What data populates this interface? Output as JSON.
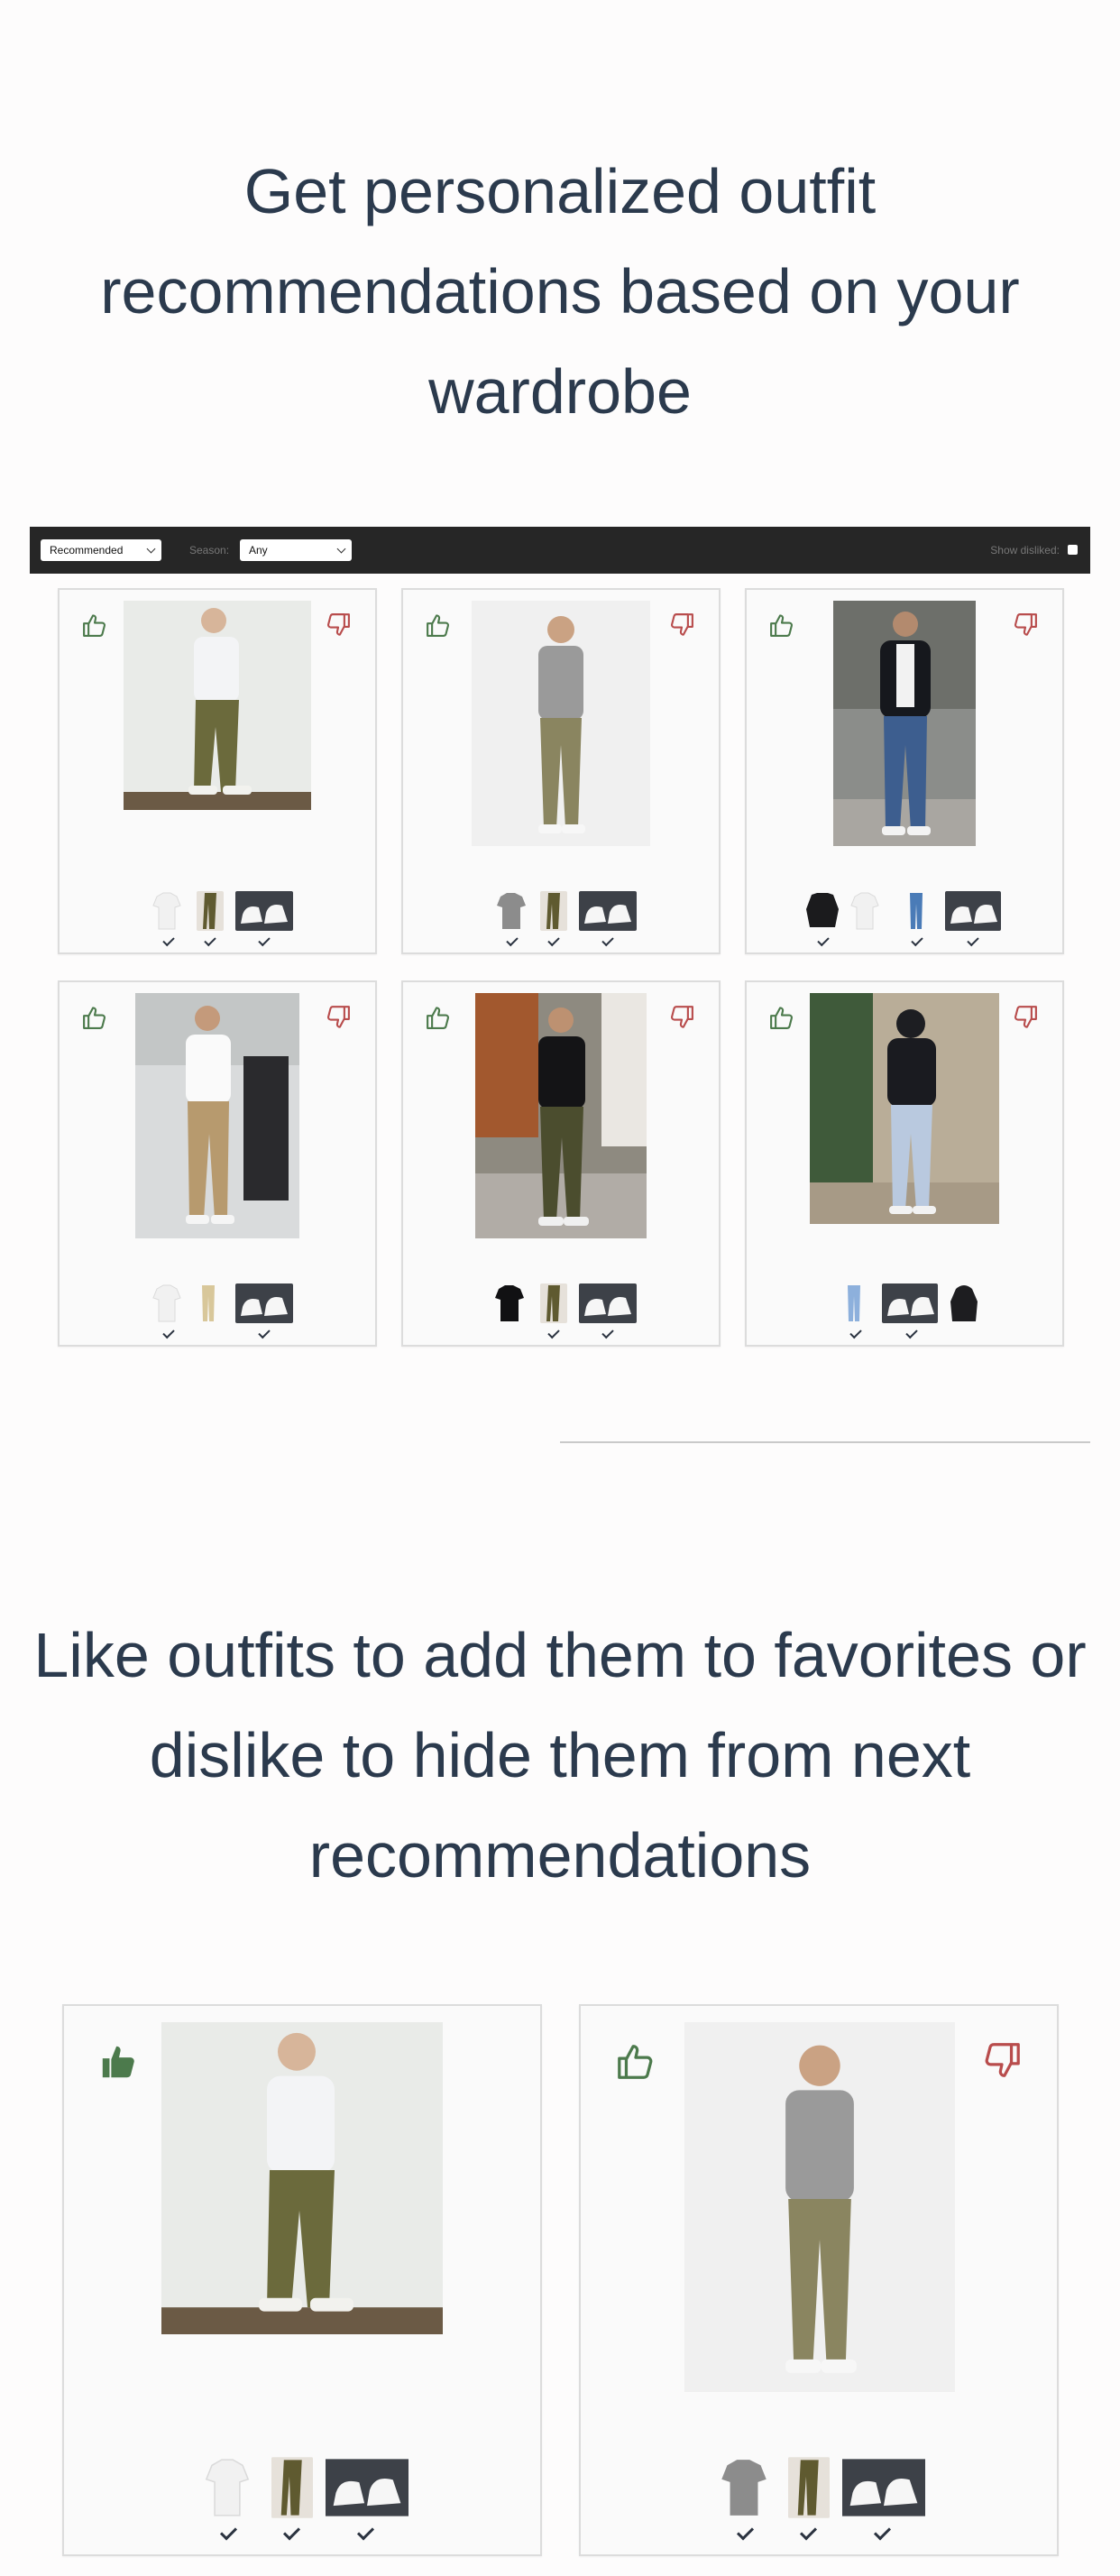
{
  "sections": {
    "heading_1": "Get personalized outfit recommendations based on your wardrobe",
    "heading_2": "Like outfits to add them to favorites or dislike to hide them from next recommendations"
  },
  "toolbar": {
    "sort_select": "Recommended",
    "season_label": "Season:",
    "season_select": "Any",
    "show_disliked_label": "Show disliked:"
  },
  "icons": {
    "like": "thumbs-up-icon",
    "dislike": "thumbs-down-icon",
    "owned": "check-icon"
  },
  "colors": {
    "like_green": "#4c7a4c",
    "dislike_red": "#b84c4c",
    "heading": "#2b3a4d",
    "toolbar_bg": "#262626"
  },
  "outfits_grid": [
    {
      "outfit": "white-tee-olive-cargo",
      "liked": false,
      "items": [
        "white t-shirt",
        "olive cargo pants",
        "white sneakers"
      ]
    },
    {
      "outfit": "grey-tee-olive-chino",
      "liked": false,
      "items": [
        "grey t-shirt",
        "olive pants",
        "white sneakers"
      ]
    },
    {
      "outfit": "bomber-jeans",
      "liked": false,
      "items": [
        "black bomber jacket",
        "white t-shirt",
        "blue jeans",
        "white sneakers"
      ]
    },
    {
      "outfit": "white-tee-khaki",
      "liked": false,
      "items": [
        "white t-shirt",
        "khaki pants",
        "white sneakers"
      ]
    },
    {
      "outfit": "black-tee-olive",
      "liked": false,
      "items": [
        "black t-shirt",
        "olive pants",
        "white sneakers"
      ]
    },
    {
      "outfit": "hoodie-ripped-jeans",
      "liked": false,
      "items": [
        "light jeans",
        "white sneakers",
        "black hoodie"
      ]
    }
  ],
  "outfits_large": [
    {
      "outfit": "white-tee-olive-cargo",
      "liked": true
    },
    {
      "outfit": "grey-tee-olive-chino",
      "liked": false
    }
  ]
}
